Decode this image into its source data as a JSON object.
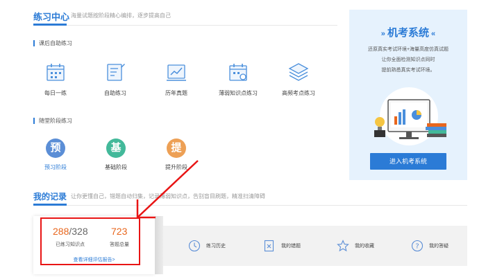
{
  "practice": {
    "title": "练习中心",
    "subtitle": "海量试题按阶段精心编排，逐步提高自己",
    "section_self": "课后自助练习",
    "tools": [
      {
        "label": "每日一练",
        "icon": "calendar-icon"
      },
      {
        "label": "自助练习",
        "icon": "notebook-pen-icon"
      },
      {
        "label": "历年真题",
        "icon": "trend-chart-icon"
      },
      {
        "label": "薄弱知识点练习",
        "icon": "calendar-alert-icon"
      },
      {
        "label": "高频考点练习",
        "icon": "stack-layers-icon"
      }
    ],
    "section_stage": "随堂阶段练习",
    "stages": [
      {
        "glyph": "预",
        "label": "预习阶段",
        "color": "#5b8ed6"
      },
      {
        "glyph": "基",
        "label": "基础阶段",
        "color": "#43b99a"
      },
      {
        "glyph": "提",
        "label": "提升阶段",
        "color": "#eda055"
      }
    ]
  },
  "exam": {
    "title": "机考系统",
    "lines": [
      "还原真实考试环境+海量高度仿真试题",
      "让你全面检测知识点同时",
      "提前熟悉真实考试环境。"
    ],
    "button": "进入机考系统"
  },
  "records": {
    "title": "我的记录",
    "subtitle": "让你更懂自己，错题自动归集，记录薄弱知识点，告别盲目刷题，精准扫清障碍",
    "practiced": "288",
    "total_points": "/328",
    "practiced_label": "已练习知识点",
    "answered": "723",
    "answered_label": "答题总量",
    "report_link": "查看详细评估报告>",
    "actions": [
      {
        "label": "练习历史",
        "icon": "clock-icon"
      },
      {
        "label": "我的错题",
        "icon": "wrong-doc-icon"
      },
      {
        "label": "我的收藏",
        "icon": "star-icon"
      },
      {
        "label": "我的答疑",
        "icon": "question-icon"
      }
    ]
  },
  "colors": {
    "brand": "#2b7bd6",
    "highlight": "#e8661d",
    "annotation": "#e81414"
  }
}
